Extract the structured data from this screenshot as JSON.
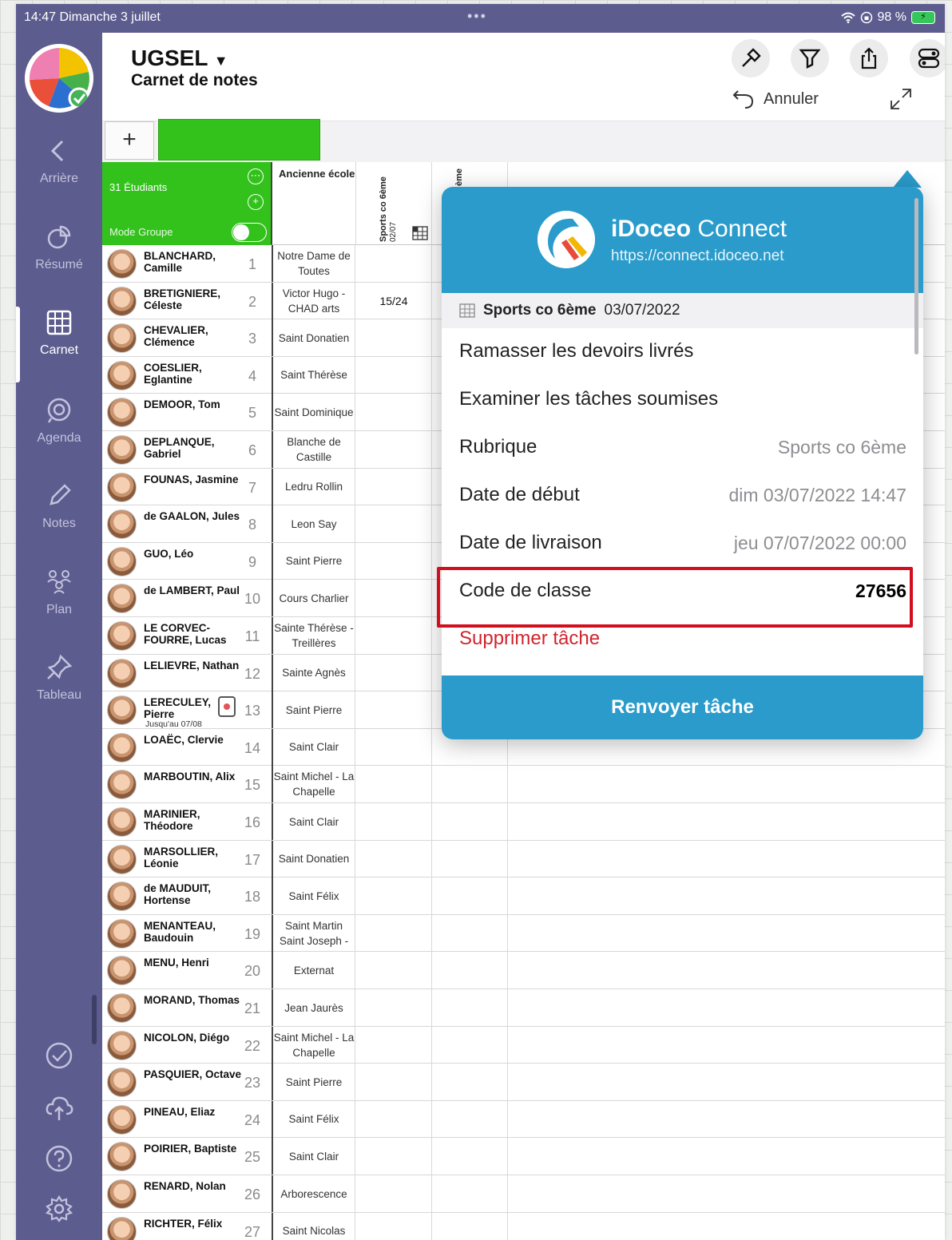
{
  "status": {
    "time": "14:47",
    "date": "Dimanche 3 juillet",
    "battery": "98 %"
  },
  "sidebar": {
    "items": [
      {
        "label": "Arrière",
        "icon": "chevron-left-icon"
      },
      {
        "label": "Résumé",
        "icon": "pie-chart-icon"
      },
      {
        "label": "Carnet",
        "icon": "grid-icon"
      },
      {
        "label": "Agenda",
        "icon": "agenda-icon"
      },
      {
        "label": "Notes",
        "icon": "pencil-icon"
      },
      {
        "label": "Plan",
        "icon": "people-icon"
      },
      {
        "label": "Tableau",
        "icon": "pin-icon"
      }
    ],
    "bottom_icons": [
      "check-circle-icon",
      "cloud-sync-icon",
      "help-icon",
      "gear-icon"
    ]
  },
  "header": {
    "title": "UGSEL",
    "subtitle": "Carnet de notes",
    "undo_label": "Annuler",
    "buttons": [
      "hammer-icon",
      "filter-icon",
      "share-icon",
      "toggles-icon"
    ]
  },
  "toolbar": {
    "add_label": "+"
  },
  "grid": {
    "student_count": "31 Étudiants",
    "group_mode_label": "Mode Groupe",
    "col_school": "Ancienne école",
    "col_sports": "Sports co 6ème",
    "col_sports_date": "02/07",
    "col_partial": "ème",
    "students": [
      {
        "name": "BLANCHARD, Camille",
        "num": "1",
        "school": "Notre Dame de Toutes",
        "grade": ""
      },
      {
        "name": "BRETIGNIERE, Céleste",
        "num": "2",
        "school": "Victor Hugo - CHAD arts",
        "grade": "15/24"
      },
      {
        "name": "CHEVALIER, Clémence",
        "num": "3",
        "school": "Saint Donatien",
        "grade": ""
      },
      {
        "name": "COESLIER, Eglantine",
        "num": "4",
        "school": "Saint Thérèse",
        "grade": ""
      },
      {
        "name": "DEMOOR, Tom",
        "num": "5",
        "school": "Saint Dominique",
        "grade": ""
      },
      {
        "name": "DEPLANQUE, Gabriel",
        "num": "6",
        "school": "Blanche de Castille",
        "grade": ""
      },
      {
        "name": "FOUNAS, Jasmine",
        "num": "7",
        "school": "Ledru Rollin",
        "grade": ""
      },
      {
        "name": "de GAALON, Jules",
        "num": "8",
        "school": "Leon Say",
        "grade": ""
      },
      {
        "name": "GUO, Léo",
        "num": "9",
        "school": "Saint Pierre",
        "grade": ""
      },
      {
        "name": "de LAMBERT, Paul",
        "num": "10",
        "school": "Cours Charlier",
        "grade": ""
      },
      {
        "name": "LE CORVEC-FOURRE, Lucas",
        "num": "11",
        "school": "Sainte Thérèse - Treillères",
        "grade": ""
      },
      {
        "name": "LELIEVRE, Nathan",
        "num": "12",
        "school": "Sainte Agnès",
        "grade": ""
      },
      {
        "name": "LERECULEY, Pierre",
        "num": "13",
        "school": "Saint Pierre",
        "grade": "",
        "sub": "Jusqu'au 07/08"
      },
      {
        "name": "LOAËC, Clervie",
        "num": "14",
        "school": "Saint Clair",
        "grade": ""
      },
      {
        "name": "MARBOUTIN, Alix",
        "num": "15",
        "school": "Saint Michel - La Chapelle",
        "grade": ""
      },
      {
        "name": "MARINIER, Théodore",
        "num": "16",
        "school": "Saint Clair",
        "grade": ""
      },
      {
        "name": "MARSOLLIER, Léonie",
        "num": "17",
        "school": "Saint Donatien",
        "grade": ""
      },
      {
        "name": "de MAUDUIT, Hortense",
        "num": "18",
        "school": "Saint Félix",
        "grade": ""
      },
      {
        "name": "MENANTEAU, Baudouin",
        "num": "19",
        "school": "Saint Martin Saint Joseph -",
        "grade": ""
      },
      {
        "name": "MENU, Henri",
        "num": "20",
        "school": "Externat",
        "grade": ""
      },
      {
        "name": "MORAND, Thomas",
        "num": "21",
        "school": "Jean Jaurès",
        "grade": ""
      },
      {
        "name": "NICOLON, Diégo",
        "num": "22",
        "school": "Saint Michel - La Chapelle",
        "grade": ""
      },
      {
        "name": "PASQUIER, Octave",
        "num": "23",
        "school": "Saint Pierre",
        "grade": ""
      },
      {
        "name": "PINEAU, Eliaz",
        "num": "24",
        "school": "Saint Félix",
        "grade": ""
      },
      {
        "name": "POIRIER, Baptiste",
        "num": "25",
        "school": "Saint Clair",
        "grade": ""
      },
      {
        "name": "RENARD, Nolan",
        "num": "26",
        "school": "Arborescence",
        "grade": ""
      },
      {
        "name": "RICHTER, Félix",
        "num": "27",
        "school": "Saint Nicolas",
        "grade": ""
      }
    ]
  },
  "popover": {
    "brand_bold": "iDoceo",
    "brand_rest": " Connect",
    "url": "https://connect.idoceo.net",
    "task_name": "Sports co 6ème",
    "task_date": "03/07/2022",
    "action1": "Ramasser les devoirs livrés",
    "action2": "Examiner les tâches soumises",
    "rubric_label": "Rubrique",
    "rubric_value": "Sports co 6ème",
    "start_label": "Date de début",
    "start_value": "dim 03/07/2022 14:47",
    "due_label": "Date de livraison",
    "due_value": "jeu 07/07/2022 00:00",
    "code_label": "Code de classe",
    "code_value": "27656",
    "delete_label": "Supprimer tâche",
    "resend_label": "Renvoyer tâche"
  },
  "colors": {
    "sidebar": "#5d5c8f",
    "green": "#33c21c",
    "accent_blue": "#2a9bcb",
    "danger": "#d0242e",
    "highlight": "#d20f1e"
  }
}
